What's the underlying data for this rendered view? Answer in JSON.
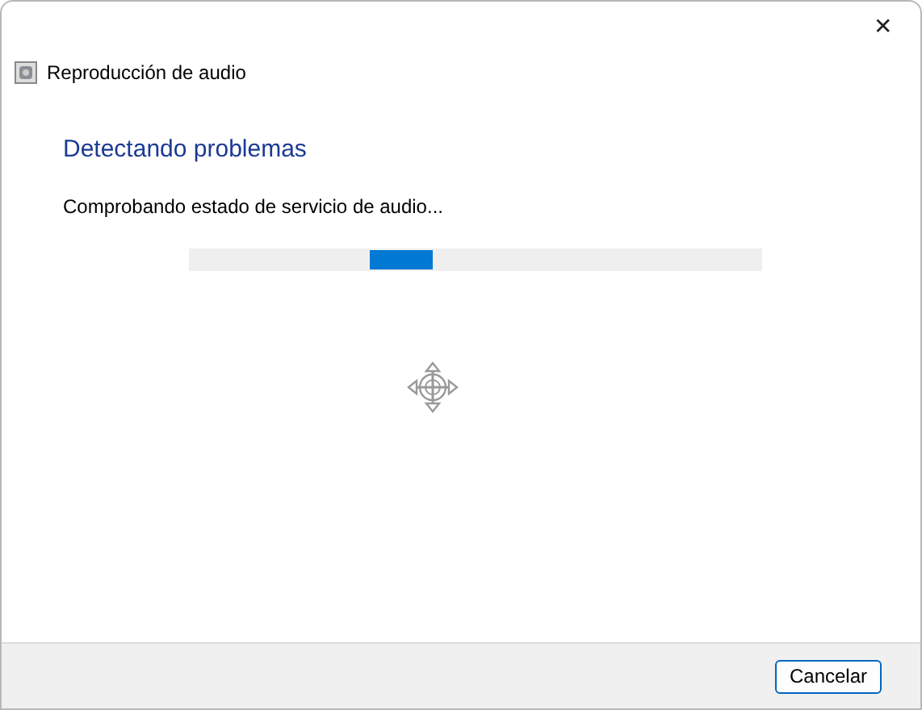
{
  "window": {
    "close_label": "✕"
  },
  "header": {
    "title": "Reproducción de audio"
  },
  "heading": "Detectando problemas",
  "status": "Comprobando estado de servicio de audio...",
  "progress": {
    "kind": "marquee"
  },
  "buttons": [
    {
      "label": "Cancelar",
      "selected": true
    }
  ]
}
